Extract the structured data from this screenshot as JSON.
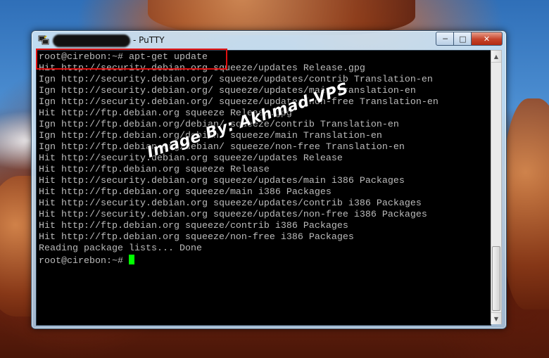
{
  "window": {
    "title": "- PuTTY",
    "buttons": {
      "minimize": "─",
      "maximize": "□",
      "close": "✕"
    }
  },
  "terminal": {
    "prompt": "root@cirebon:~#",
    "lines": [
      "root@cirebon:~# apt-get update",
      "Hit http://security.debian.org squeeze/updates Release.gpg",
      "Ign http://security.debian.org/ squeeze/updates/contrib Translation-en",
      "Ign http://security.debian.org/ squeeze/updates/main Translation-en",
      "Ign http://security.debian.org/ squeeze/updates/non-free Translation-en",
      "Hit http://ftp.debian.org squeeze Release.gpg",
      "Ign http://ftp.debian.org/debian/ squeeze/contrib Translation-en",
      "Ign http://ftp.debian.org/debian/ squeeze/main Translation-en",
      "Ign http://ftp.debian.org/debian/ squeeze/non-free Translation-en",
      "Hit http://security.debian.org squeeze/updates Release",
      "Hit http://ftp.debian.org squeeze Release",
      "Hit http://security.debian.org squeeze/updates/main i386 Packages",
      "Hit http://ftp.debian.org squeeze/main i386 Packages",
      "Hit http://security.debian.org squeeze/updates/contrib i386 Packages",
      "Hit http://security.debian.org squeeze/updates/non-free i386 Packages",
      "Hit http://ftp.debian.org squeeze/contrib i386 Packages",
      "Hit http://ftp.debian.org squeeze/non-free i386 Packages",
      "Reading package lists... Done",
      "root@cirebon:~#"
    ],
    "text_color": "#bbbbbb",
    "cursor_color": "#00ff00"
  },
  "watermark": "Image By: Akhmad-VPS",
  "scrollbar": {
    "up_arrow": "▲",
    "down_arrow": "▼"
  },
  "colors": {
    "highlight_box": "#e01010",
    "terminal_bg": "#000000"
  }
}
